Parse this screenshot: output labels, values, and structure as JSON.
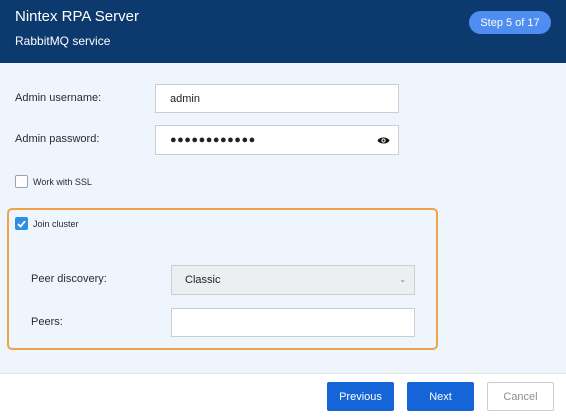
{
  "header": {
    "title": "Nintex RPA Server",
    "subtitle": "RabbitMQ service",
    "step_badge": "Step 5 of 17"
  },
  "form": {
    "admin_username": {
      "label": "Admin username:",
      "value": "admin"
    },
    "admin_password": {
      "label": "Admin password:",
      "value": "●●●●●●●●●●●●",
      "icon": "eye-icon"
    },
    "ssl": {
      "label": "Work with SSL",
      "checked": false
    },
    "cluster": {
      "label": "Join cluster",
      "checked": true,
      "peer_discovery": {
        "label": "Peer discovery:",
        "value": "Classic"
      },
      "peers": {
        "label": "Peers:",
        "value": ""
      }
    }
  },
  "footer": {
    "previous_label": "Previous",
    "next_label": "Next",
    "cancel_label": "Cancel"
  },
  "colors": {
    "header_bg": "#0c3a6e",
    "badge_bg": "#4f8df0",
    "content_bg": "#eef5fd",
    "highlight_border": "#f0a24b",
    "primary_button": "#1565d8",
    "checkbox_checked": "#2f8fe0"
  }
}
